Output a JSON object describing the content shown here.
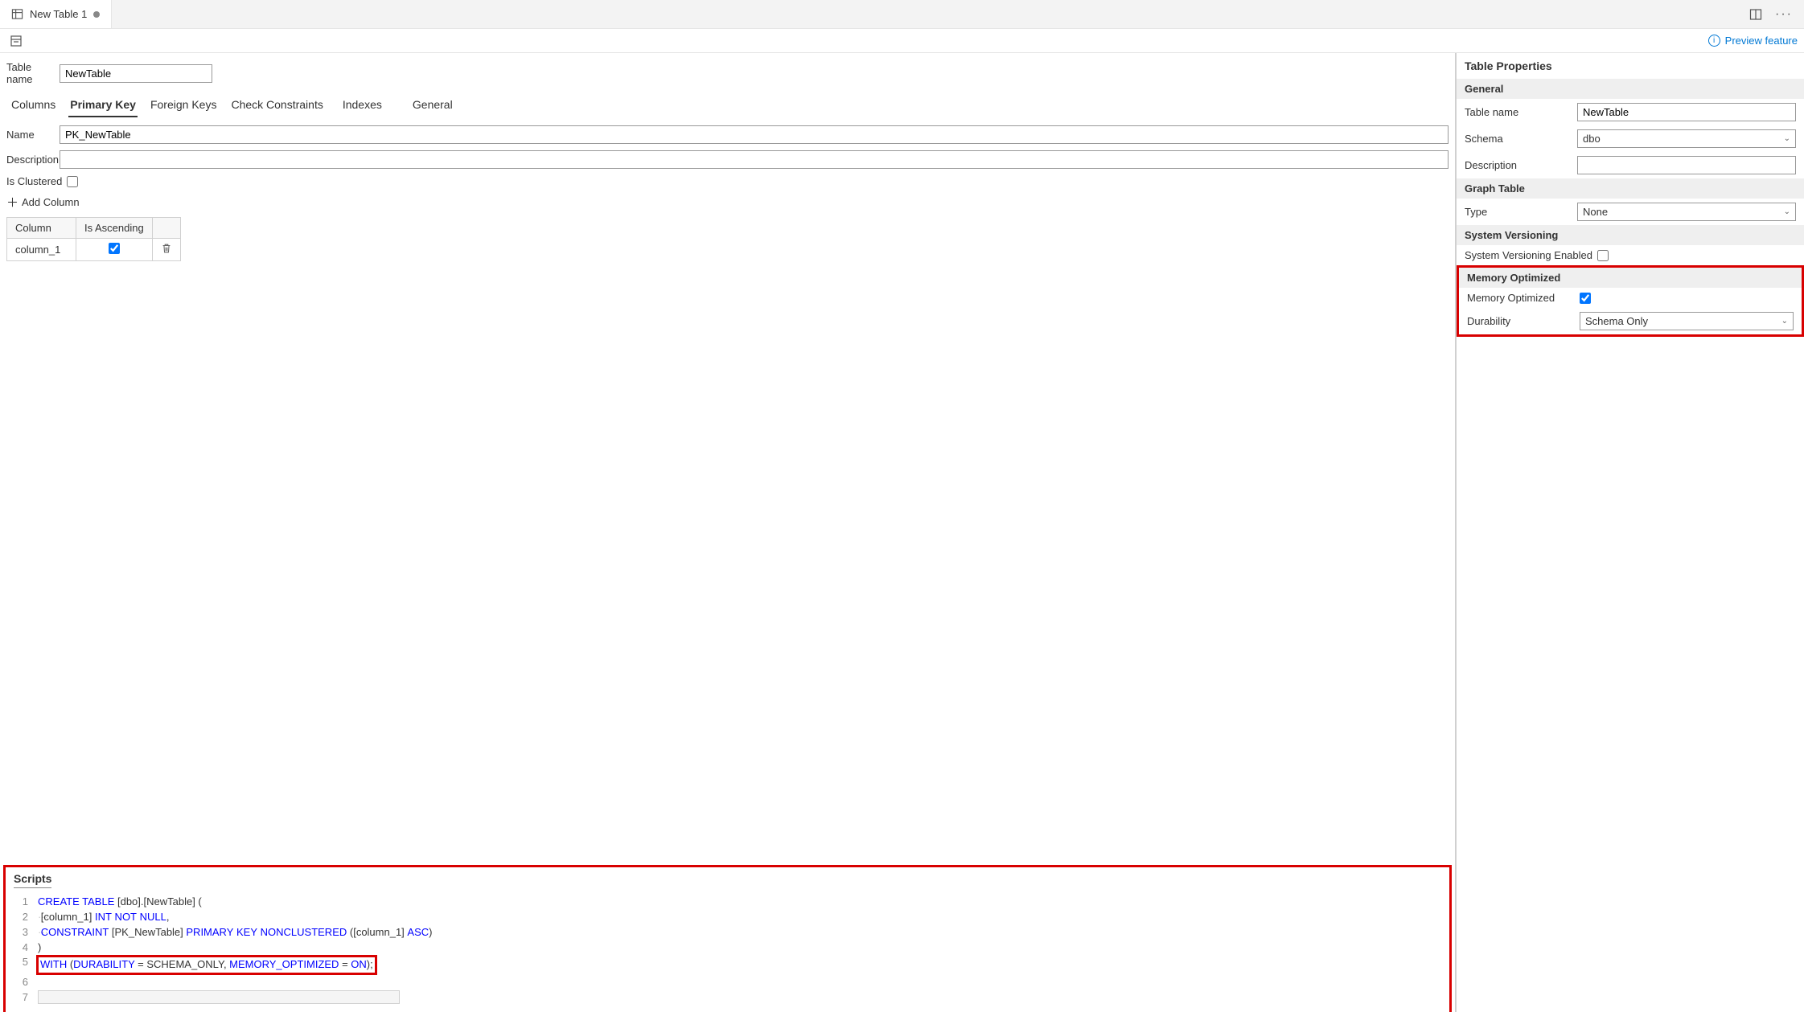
{
  "tab": {
    "title": "New Table 1"
  },
  "toolbar": {
    "preview_label": "Preview feature"
  },
  "form": {
    "table_name_label": "Table name",
    "table_name_value": "NewTable",
    "section_tabs": [
      "Columns",
      "Primary Key",
      "Foreign Keys",
      "Check Constraints",
      "Indexes",
      "General"
    ],
    "active_tab_index": 1,
    "pk_name_label": "Name",
    "pk_name_value": "PK_NewTable",
    "desc_label": "Description",
    "desc_value": "",
    "is_clustered_label": "Is Clustered",
    "add_column_label": "Add Column",
    "grid": {
      "col_header": "Column",
      "asc_header": "Is Ascending",
      "rows": [
        {
          "column": "column_1",
          "ascending": true
        }
      ]
    }
  },
  "scripts": {
    "title": "Scripts",
    "lines": {
      "l1_create": "CREATE",
      "l1_table": " TABLE",
      "l1_rest": " [dbo].[NewTable] (",
      "l2_pre": "    [column_1] ",
      "l2_int": "INT",
      "l2_not": " NOT",
      "l2_null": " NULL",
      "l2_comma": ",",
      "l3_pre": "    ",
      "l3_constraint": "CONSTRAINT",
      "l3_mid": " [PK_NewTable] ",
      "l3_primary": "PRIMARY",
      "l3_key": " KEY",
      "l3_nonclustered": " NONCLUSTERED",
      "l3_cols": " ([column_1] ",
      "l3_asc": "ASC",
      "l3_close": ")",
      "l4": ")",
      "l5_with": "WITH",
      "l5_open": " (",
      "l5_dur": "DURABILITY",
      "l5_eq1": " = SCHEMA_ONLY, ",
      "l5_mem": "MEMORY_OPTIMIZED",
      "l5_eq2": " = ",
      "l5_on": "ON",
      "l5_close": ");"
    }
  },
  "props": {
    "title": "Table Properties",
    "general_hdr": "General",
    "table_name_lbl": "Table name",
    "table_name_val": "NewTable",
    "schema_lbl": "Schema",
    "schema_val": "dbo",
    "description_lbl": "Description",
    "description_val": "",
    "graph_hdr": "Graph Table",
    "type_lbl": "Type",
    "type_val": "None",
    "sysver_hdr": "System Versioning",
    "sysver_enabled_lbl": "System Versioning Enabled",
    "memopt_hdr": "Memory Optimized",
    "memopt_lbl": "Memory Optimized",
    "durability_lbl": "Durability",
    "durability_val": "Schema Only"
  }
}
